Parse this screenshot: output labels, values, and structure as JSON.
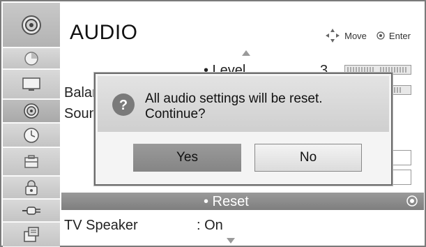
{
  "header": {
    "title": "AUDIO"
  },
  "hint": {
    "move_label": "Move",
    "enter_label": "Enter"
  },
  "menu": {
    "level": {
      "label": "• Level",
      "value": "3"
    },
    "balance": {
      "label": "Balance"
    },
    "sound": {
      "label": "Sound"
    },
    "reset": {
      "label": "• Reset"
    },
    "tv_speaker": {
      "label": "TV Speaker",
      "value": ": On"
    }
  },
  "dialog": {
    "line1": "All audio settings will be reset.",
    "line2": "Continue?",
    "yes_label": "Yes",
    "no_label": "No",
    "question_glyph": "?"
  },
  "sidebar": {
    "items": [
      {
        "icon": "audio-speaker-icon",
        "active": false
      },
      {
        "icon": "picture-icon",
        "active": false
      },
      {
        "icon": "monitor-icon",
        "active": false
      },
      {
        "icon": "audio-icon",
        "active": true
      },
      {
        "icon": "time-icon",
        "active": false
      },
      {
        "icon": "option-icon",
        "active": false
      },
      {
        "icon": "lock-icon",
        "active": false
      },
      {
        "icon": "input-icon",
        "active": false
      },
      {
        "icon": "usb-icon",
        "active": false
      }
    ]
  }
}
